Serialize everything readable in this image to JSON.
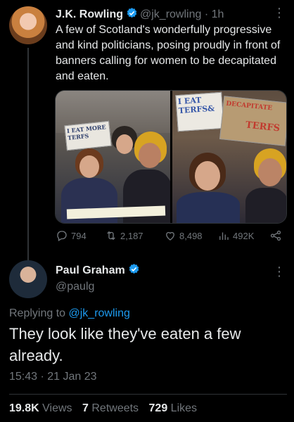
{
  "tweet1": {
    "name": "J.K. Rowling",
    "handle": "@jk_rowling",
    "separator": "·",
    "time": "1h",
    "text": "A few of Scotland's wonderfully progressive and kind politicians, posing proudly in front of banners calling for women to be decapitated and eaten.",
    "media": {
      "photo1_sign": "I EAT MORE TERFS",
      "photo2_sign_left": "I EAT TERFS&",
      "photo2_sign_right_top": "DECAPITATE",
      "photo2_sign_right_bottom": "TERFS"
    },
    "actions": {
      "replies": "794",
      "retweets": "2,187",
      "likes": "8,498",
      "views": "492K"
    }
  },
  "tweet2": {
    "name": "Paul Graham",
    "handle": "@paulg",
    "replying_prefix": "Replying to",
    "replying_to": "@jk_rowling",
    "text": "They look like they've eaten a few already.",
    "time": "15:43",
    "date": "21 Jan 23",
    "meta_separator": "·",
    "stats": {
      "views_count": "19.8K",
      "views_label": "Views",
      "retweets_count": "7",
      "retweets_label": "Retweets",
      "likes_count": "729",
      "likes_label": "Likes"
    }
  },
  "colors": {
    "background": "#000000",
    "text": "#e7e9ea",
    "secondary": "#71767b",
    "accent": "#1d9bf0"
  }
}
